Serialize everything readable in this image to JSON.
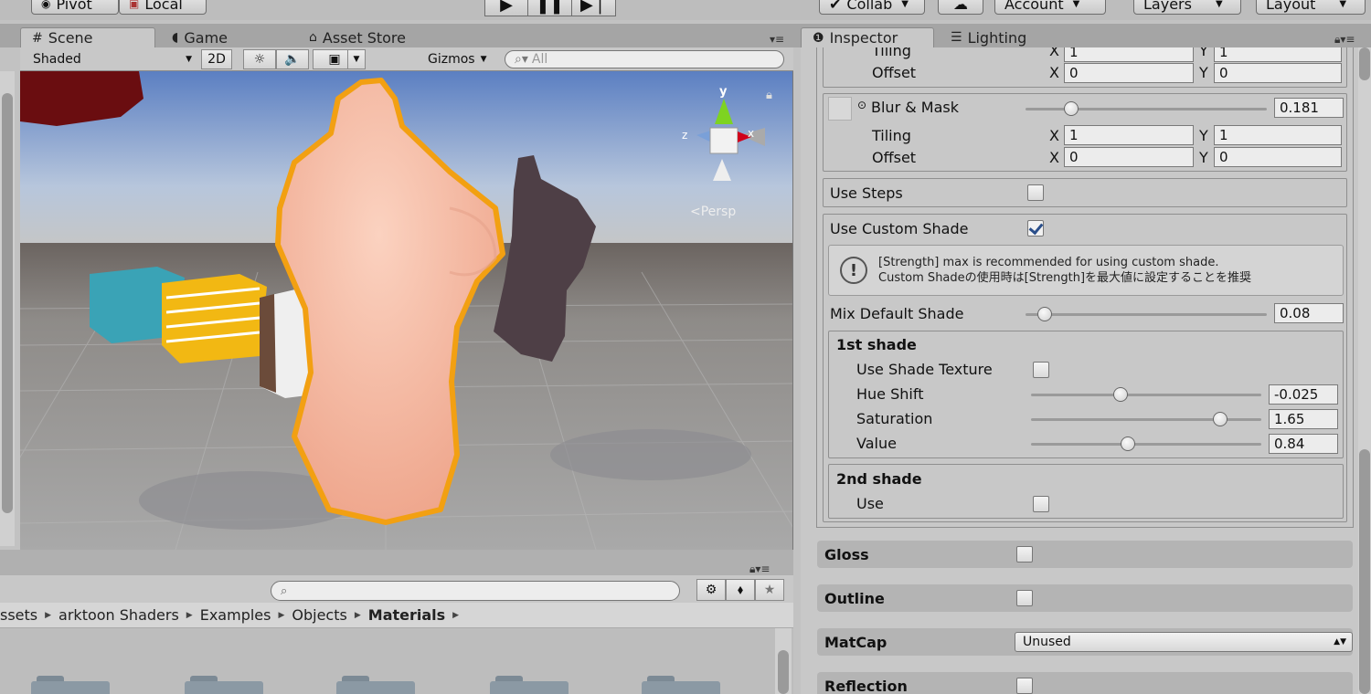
{
  "toolbar": {
    "pivot": "Pivot",
    "local": "Local",
    "collab": "Collab",
    "account": "Account",
    "layers": "Layers",
    "layout": "Layout"
  },
  "scene_tabs": {
    "scene": "Scene",
    "game": "Game",
    "asset_store": "Asset Store"
  },
  "scene_tools": {
    "shading": "Shaded",
    "two_d": "2D",
    "gizmos": "Gizmos",
    "search_placeholder": "All"
  },
  "viewport": {
    "persp_label": "Persp",
    "axis_y": "y",
    "axis_x": "x",
    "axis_z": "z"
  },
  "project": {
    "breadcrumb": [
      "ssets",
      "arktoon Shaders",
      "Examples",
      "Objects",
      "Materials"
    ]
  },
  "inspector_tabs": {
    "inspector": "Inspector",
    "lighting": "Lighting"
  },
  "inspector": {
    "tiling_top": {
      "label": "Tiling",
      "x": "1",
      "y": "1"
    },
    "offset_top": {
      "label": "Offset",
      "x": "0",
      "y": "0"
    },
    "blur_mask": {
      "label": "Blur & Mask",
      "value": "0.181",
      "fraction": 0.19
    },
    "tiling": {
      "label": "Tiling",
      "x": "1",
      "y": "1"
    },
    "offset": {
      "label": "Offset",
      "x": "0",
      "y": "0"
    },
    "x_label": "X",
    "y_label": "Y",
    "use_steps": {
      "label": "Use Steps",
      "checked": false
    },
    "use_custom_shade": {
      "label": "Use Custom Shade",
      "checked": true
    },
    "help_line1": "[Strength] max is recommended for using custom shade.",
    "help_line2": "Custom Shadeの使用時は[Strength]を最大値に設定することを推奨",
    "mix_default_shade": {
      "label": "Mix Default Shade",
      "value": "0.08",
      "fraction": 0.08
    },
    "first_shade": {
      "title": "1st shade",
      "use_shade_texture": "Use Shade Texture",
      "hue_shift": {
        "label": "Hue Shift",
        "value": "-0.025",
        "fraction": 0.39
      },
      "saturation": {
        "label": "Saturation",
        "value": "1.65",
        "fraction": 0.82
      },
      "value": {
        "label": "Value",
        "value": "0.84",
        "fraction": 0.42
      }
    },
    "second_shade": {
      "title": "2nd shade",
      "use": "Use"
    },
    "gloss": "Gloss",
    "outline": "Outline",
    "matcap": {
      "label": "MatCap",
      "value": "Unused"
    },
    "reflection": "Reflection"
  }
}
